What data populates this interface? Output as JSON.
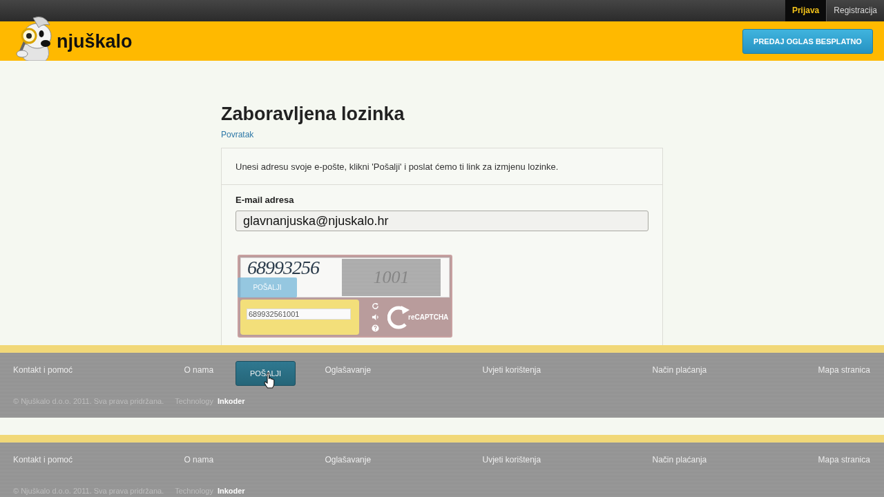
{
  "top_bar": {
    "links": [
      {
        "label": "Prijava",
        "selected": true
      },
      {
        "label": "Registracija",
        "selected": false
      }
    ]
  },
  "header": {
    "logo_text": "njuškalo",
    "cta_button": "PREDAJ OGLAS BESPLATNO"
  },
  "page": {
    "title": "Zaboravljena lozinka",
    "back_link": "Povratak"
  },
  "form": {
    "intro": "Unesi adresu svoje e-pošte, klikni 'Pošalji' i poslat ćemo ti link za izmjenu lozinke.",
    "email_label": "E-mail adresa",
    "email_value": "glavnanjuska@njuskalo.hr",
    "captcha": {
      "image_word_1": "68993256",
      "image_word_2": "1001",
      "answer_value": "689932561001",
      "brand": "reCAPTCHA"
    },
    "faded_button": "POŠALJI",
    "submit_button": "POŠALJI"
  },
  "footers": [
    {
      "links": [
        "Kontakt i pomoć",
        "O nama",
        "Oglašavanje",
        "Uvjeti korištenja",
        "Način plaćanja",
        "Mapa stranica"
      ],
      "copyright": "© Njuškalo d.o.o. 2011. Sva prava pridržana.",
      "credit_label": "Technology",
      "credit_name": "Inkoder"
    },
    {
      "links": [
        "Kontakt i pomoć",
        "O nama",
        "Oglašavanje",
        "Uvjeti korištenja",
        "Način plaćanja",
        "Mapa stranica"
      ],
      "copyright": "© Njuškalo d.o.o. 2011. Sva prava pridržana.",
      "credit_label": "Technology",
      "credit_name": "Inkoder"
    }
  ]
}
